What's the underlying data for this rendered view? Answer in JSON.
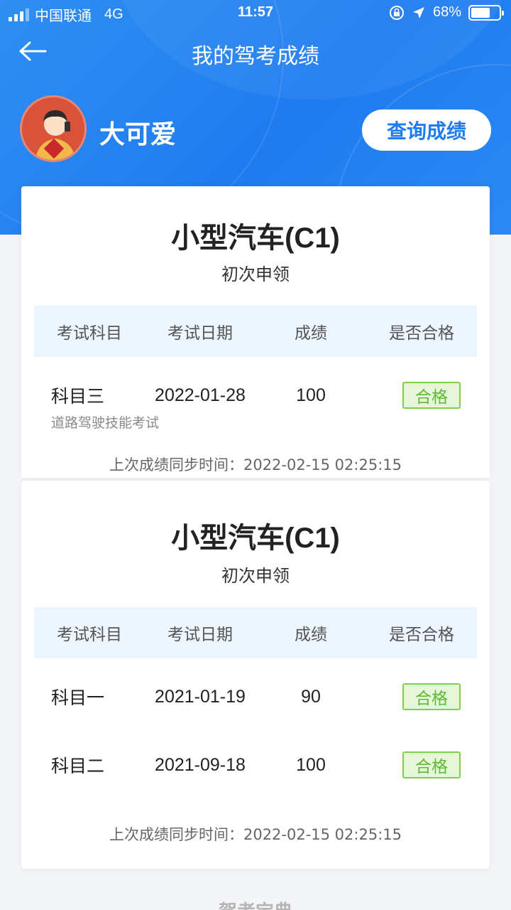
{
  "status_bar": {
    "carrier": "中国联通",
    "network": "4G",
    "time": "11:57",
    "battery": "68%",
    "battery_level": 0.68
  },
  "nav": {
    "title": "我的驾考成绩"
  },
  "profile": {
    "name": "大可爱",
    "query_button": "查询成绩"
  },
  "cards": [
    {
      "title": "小型汽车(C1)",
      "subtitle": "初次申领",
      "headers": [
        "考试科目",
        "考试日期",
        "成绩",
        "是否合格"
      ],
      "rows": [
        {
          "subject": "科目三",
          "desc": "道路驾驶技能考试",
          "date": "2022-01-28",
          "score": "100",
          "result": "合格"
        }
      ],
      "sync": "上次成绩同步时间：2022-02-15 02:25:15"
    },
    {
      "title": "小型汽车(C1)",
      "subtitle": "初次申领",
      "headers": [
        "考试科目",
        "考试日期",
        "成绩",
        "是否合格"
      ],
      "rows": [
        {
          "subject": "科目一",
          "date": "2021-01-19",
          "score": "90",
          "result": "合格"
        },
        {
          "subject": "科目二",
          "date": "2021-09-18",
          "score": "100",
          "result": "合格"
        }
      ],
      "sync": "上次成绩同步时间：2022-02-15 02:25:15"
    }
  ],
  "footer": {
    "peek_text": "驾考宝典"
  },
  "colors": {
    "primary": "#1f7cf0",
    "pass_green": "#5fb832",
    "table_header_bg": "#edf5ff"
  }
}
